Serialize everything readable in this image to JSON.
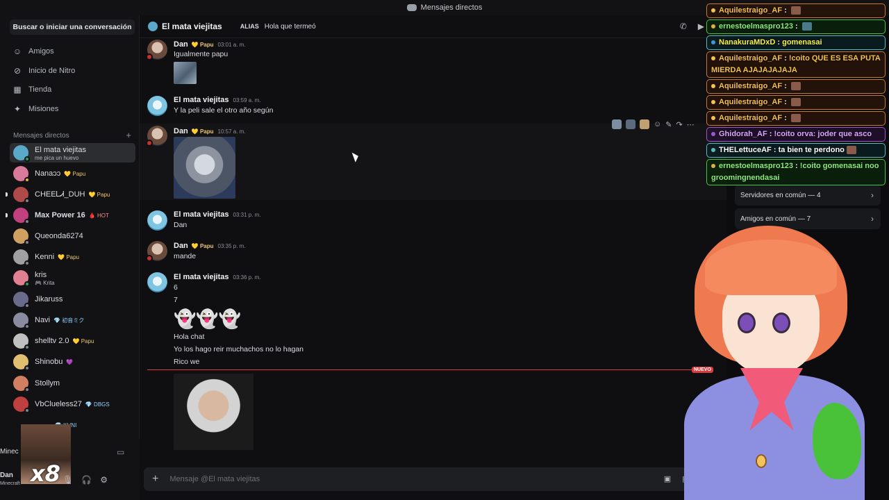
{
  "window": {
    "title": "Mensajes directos"
  },
  "sidebar": {
    "search_label": "Buscar o iniciar una conversación",
    "nav": [
      {
        "label": "Amigos",
        "icon": "friends-icon"
      },
      {
        "label": "Inicio de Nitro",
        "icon": "nitro-icon"
      },
      {
        "label": "Tienda",
        "icon": "shop-icon"
      },
      {
        "label": "Misiones",
        "icon": "quests-icon"
      }
    ],
    "dm_header": "Mensajes directos",
    "dm_add": "+",
    "dms": [
      {
        "name": "El mata viejitas",
        "sub": "me pica un huevo",
        "active": true,
        "color": "#5aa9c9"
      },
      {
        "name": "Nanaↄↄ",
        "badge": "💛 Papu",
        "color": "#d97a9a"
      },
      {
        "name": "CHEEᏞᏗ_DUH",
        "badge": "💛 Papu",
        "color": "#b04a4a"
      },
      {
        "name": "Max Power 16",
        "badge": "🩸 HOT",
        "color": "#c04080"
      },
      {
        "name": "Queonda6274",
        "color": "#d0a060"
      },
      {
        "name": "Kenni",
        "badge": "💛 Papu",
        "color": "#a0a0a0"
      },
      {
        "name": "kris",
        "sub": "🎮 Krita",
        "color": "#e08090"
      },
      {
        "name": "Jikaruss",
        "color": "#6a6a8a"
      },
      {
        "name": "Navi",
        "badge": "💎 初音ミク",
        "color": "#8a8aa0"
      },
      {
        "name": "shelltv 2.0",
        "badge": "💛 Papu",
        "color": "#c0c0c0"
      },
      {
        "name": "Shinobu",
        "badge": "💜",
        "color": "#e0c070"
      },
      {
        "name": "Stollym",
        "color": "#d08060"
      },
      {
        "name": "VbClueless27",
        "badge": "💎 DBGS",
        "color": "#c04040"
      },
      {
        "name": "",
        "badge": "💎 KUNI",
        "color": "#909090"
      }
    ],
    "user": {
      "activity": "Minec",
      "name": "Dan",
      "sub": "Minecraft",
      "meme_text": "x8"
    }
  },
  "header": {
    "name": "El mata viejitas",
    "alias_label": "ALIAS",
    "alias_value": "Hola que termeó"
  },
  "messages": {
    "m1": {
      "author": "Dan",
      "tag": "💛 Papu",
      "time": "03:01 a. m.",
      "text": "Igualmente papu"
    },
    "m2": {
      "author": "El mata viejitas",
      "time": "03:59 a. m.",
      "text": "Y la peli sale el otro año según"
    },
    "m3": {
      "author": "Dan",
      "tag": "💛 Papu",
      "time": "10:57 a. m."
    },
    "m4": {
      "author": "El mata viejitas",
      "time": "03:31 p. m.",
      "text": "Dan"
    },
    "m5": {
      "author": "Dan",
      "tag": "💛 Papu",
      "time": "03:35 p. m.",
      "text": "mande"
    },
    "m6": {
      "author": "El mata viejitas",
      "time": "03:36 p. m.",
      "lines": [
        "6",
        "7"
      ],
      "ghosts": "👻👻👻",
      "more": [
        "Hola chat",
        "Yo los hago reir muchachos no lo hagan",
        "Rico we"
      ]
    },
    "new_label": "NUEVO"
  },
  "composer": {
    "placeholder": "Mensaje @El mata viejitas",
    "plus": "+"
  },
  "profile": {
    "servers": "Servidores en común — 4",
    "friends": "Amigos en común — 7"
  },
  "stream_chat": [
    {
      "user": "Aquilestraigo_AF",
      "text": "",
      "style": "orange"
    },
    {
      "user": "ernestoelmaspro123",
      "text": "",
      "style": "green"
    },
    {
      "user": "NanakuraMDxD",
      "text": "gomenasai",
      "style": "teal"
    },
    {
      "user": "Aquilestraigo_AF",
      "text": "!coito QUE ES ESA PUTA MIERDA AJAJAJAJAJA",
      "style": "orange"
    },
    {
      "user": "Aquilestraigo_AF",
      "text": "",
      "style": "orange"
    },
    {
      "user": "Aquilestraigo_AF",
      "text": "",
      "style": "orange"
    },
    {
      "user": "Aquilestraigo_AF",
      "text": "",
      "style": "orange"
    },
    {
      "user": "Ghidorah_AF",
      "text": "!coito orva: joder que asco",
      "style": "purple"
    },
    {
      "user": "THELettuceAF",
      "text": "ta bien te perdono",
      "style": "teal"
    },
    {
      "user": "ernestoelmaspro123",
      "text": "!coito gomenasai noo groomingnendasai",
      "style": "green"
    }
  ],
  "colors": {
    "accent": "#5865f2",
    "new_line": "#d83c3e",
    "online": "#23a55a"
  }
}
